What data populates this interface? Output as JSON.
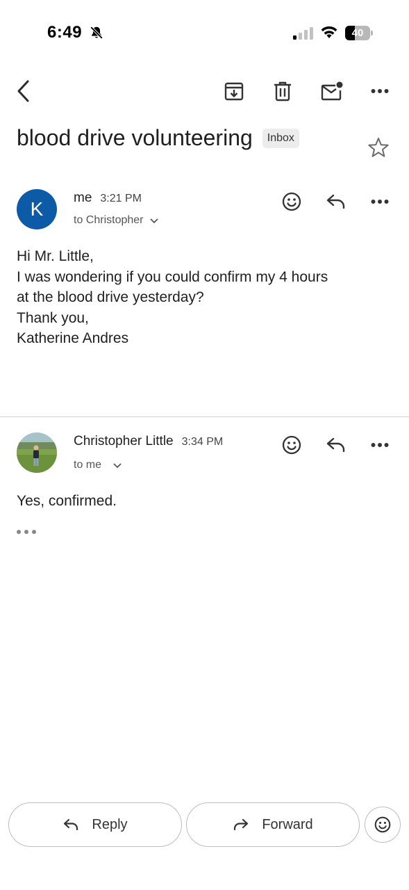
{
  "status_bar": {
    "time": "6:49",
    "battery_level": "40",
    "battery_fraction": 0.4,
    "icons": [
      "bell-off-icon",
      "cellular-signal-icon",
      "wifi-icon",
      "battery-icon"
    ]
  },
  "toolbar": {
    "icons": [
      "back-icon",
      "archive-icon",
      "delete-icon",
      "mark-unread-icon",
      "more-icon"
    ]
  },
  "thread": {
    "subject": "blood drive volunteering",
    "label": "Inbox",
    "star_icon": "star-outline-icon"
  },
  "messages": [
    {
      "avatar_letter": "K",
      "avatar_color": "#0d5aa7",
      "sender": "me",
      "time": "3:21 PM",
      "recipient": "to Christopher",
      "body": [
        "Hi Mr. Little,",
        "I was wondering if you could confirm my 4 hours",
        "at the blood drive yesterday?",
        "Thank you,",
        "Katherine Andres"
      ]
    },
    {
      "avatar_type": "photo",
      "sender": "Christopher Little",
      "time": "3:34 PM",
      "recipient": "to me",
      "body": [
        "Yes, confirmed."
      ]
    }
  ],
  "bottom_bar": {
    "reply_label": "Reply",
    "forward_label": "Forward"
  },
  "colors": {
    "text": "#1f1f1f",
    "secondary_text": "#555555",
    "avatar_blue": "#0d5aa7",
    "chip_bg": "#ececec"
  }
}
